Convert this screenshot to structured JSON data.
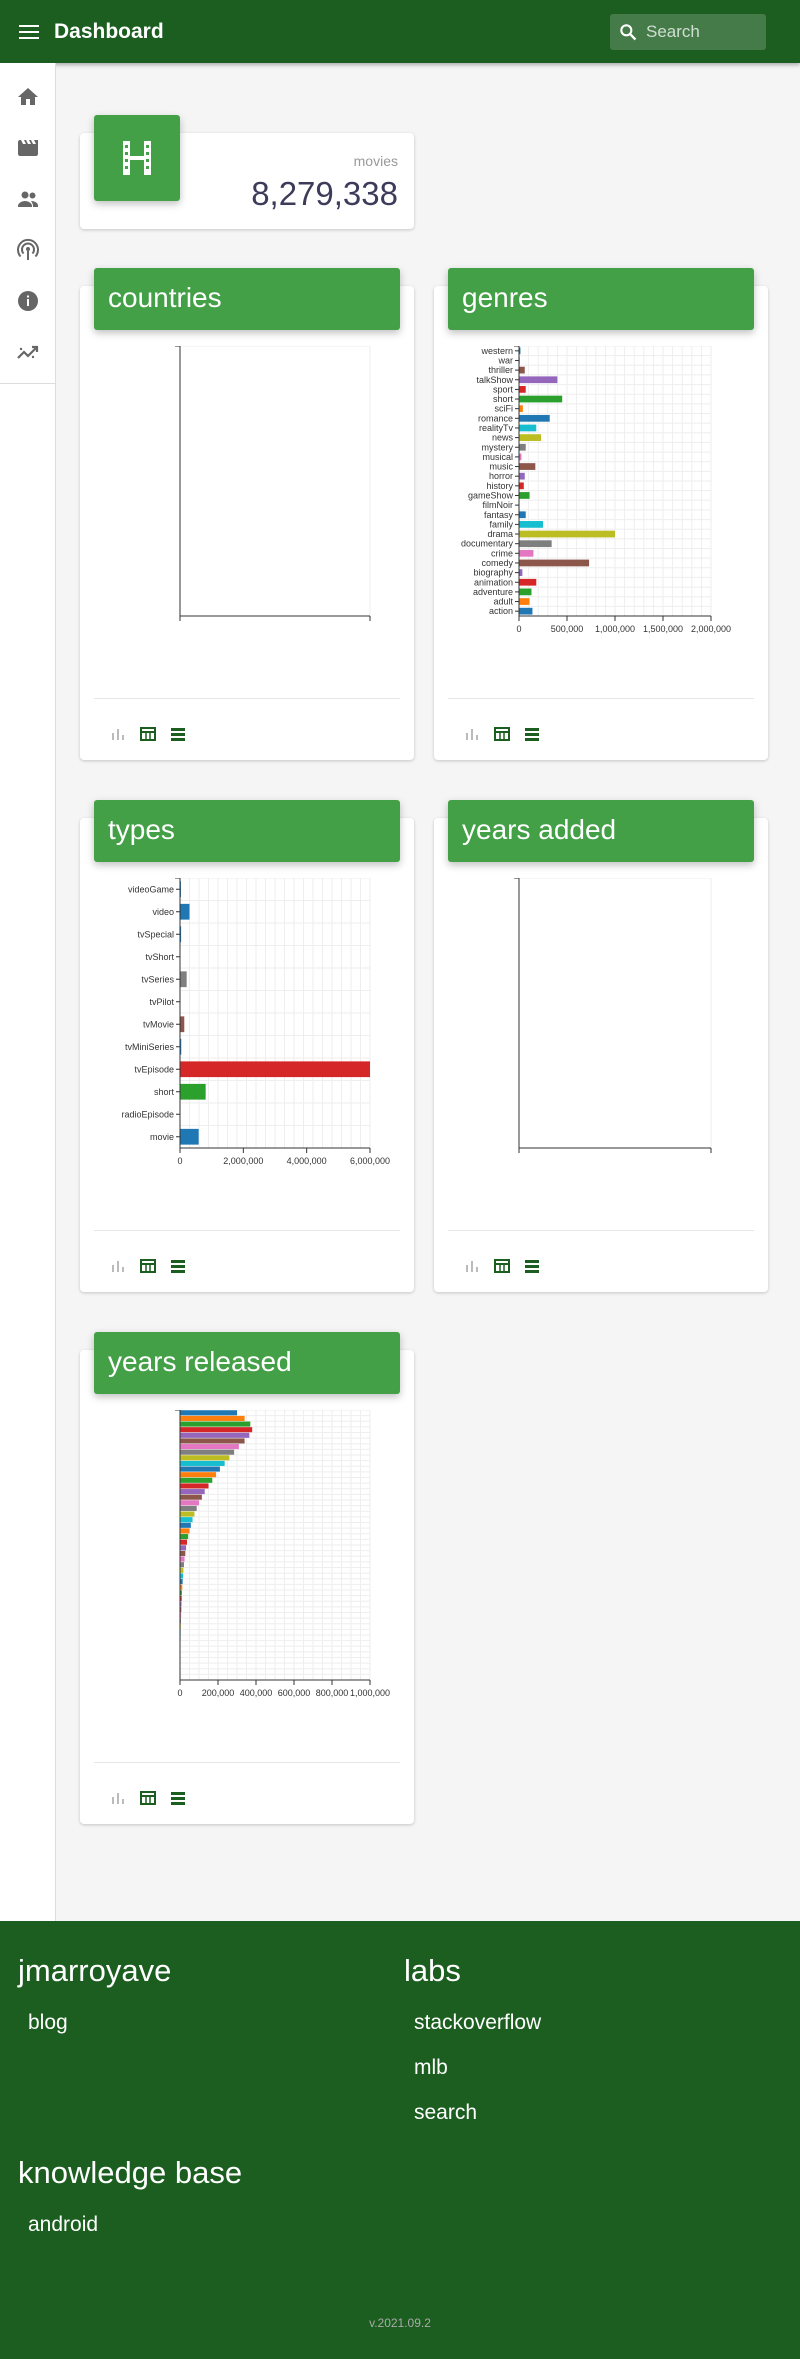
{
  "header": {
    "title": "Dashboard",
    "search_placeholder": "Search"
  },
  "sidebar": {
    "items": [
      "home-icon",
      "movie-icon",
      "people-icon",
      "podcast-icon",
      "info-icon",
      "trending-icon"
    ]
  },
  "stats": {
    "label": "movies",
    "value": "8,279,338"
  },
  "colors": {
    "dark_green": "#1b5e20",
    "green": "#43a047",
    "action_green": "#1b5e20"
  },
  "cards": {
    "countries": {
      "title": "countries"
    },
    "genres": {
      "title": "genres"
    },
    "types": {
      "title": "types"
    },
    "years_added": {
      "title": "years added"
    },
    "years_released": {
      "title": "years released"
    }
  },
  "chart_data": [
    {
      "type": "bar",
      "orientation": "horizontal",
      "id": "countries",
      "categories": [],
      "values": []
    },
    {
      "type": "bar",
      "orientation": "horizontal",
      "id": "genres",
      "categories": [
        "western",
        "war",
        "thriller",
        "talkShow",
        "sport",
        "short",
        "sciFi",
        "romance",
        "realityTv",
        "news",
        "mystery",
        "musical",
        "music",
        "horror",
        "history",
        "gameShow",
        "filmNoir",
        "fantasy",
        "family",
        "drama",
        "documentary",
        "crime",
        "comedy",
        "biography",
        "animation",
        "adventure",
        "adult",
        "action"
      ],
      "values": [
        15000,
        8000,
        60000,
        400000,
        70000,
        450000,
        40000,
        320000,
        180000,
        230000,
        70000,
        25000,
        170000,
        60000,
        50000,
        110000,
        3000,
        70000,
        250000,
        1000000,
        340000,
        150000,
        730000,
        35000,
        180000,
        130000,
        110000,
        140000
      ],
      "colors": [
        "#1f77b4",
        "#ff7f0e",
        "#8c564b",
        "#9467bd",
        "#d62728",
        "#2ca02c",
        "#ff7f0e",
        "#1f77b4",
        "#17becf",
        "#bcbd22",
        "#7f7f7f",
        "#e377c2",
        "#8c564b",
        "#9467bd",
        "#d62728",
        "#2ca02c",
        "#1f77b4",
        "#1f77b4",
        "#17becf",
        "#bcbd22",
        "#7f7f7f",
        "#e377c2",
        "#8c564b",
        "#9467bd",
        "#d62728",
        "#2ca02c",
        "#ff7f0e",
        "#1f77b4"
      ],
      "xticks": [
        "0",
        "500,000",
        "1,000,000",
        "1,500,000",
        "2,000,000"
      ],
      "xlim": [
        0,
        2000000
      ]
    },
    {
      "type": "bar",
      "orientation": "horizontal",
      "id": "types",
      "categories": [
        "videoGame",
        "video",
        "tvSpecial",
        "tvShort",
        "tvSeries",
        "tvPilot",
        "tvMovie",
        "tvMiniSeries",
        "tvEpisode",
        "short",
        "radioEpisode",
        "movie"
      ],
      "values": [
        30000,
        300000,
        35000,
        10000,
        210000,
        1000,
        135000,
        40000,
        6050000,
        810000,
        10,
        590000
      ],
      "colors": [
        "#1f77b4",
        "#1f77b4",
        "#1f77b4",
        "#1f77b4",
        "#7f7f7f",
        "#1f77b4",
        "#8c564b",
        "#1f77b4",
        "#d62728",
        "#2ca02c",
        "#1f77b4",
        "#1f77b4"
      ],
      "xticks": [
        "0",
        "2,000,000",
        "4,000,000",
        "6,000,000"
      ],
      "xlim": [
        0,
        6000000
      ]
    },
    {
      "type": "bar",
      "orientation": "horizontal",
      "id": "years_added",
      "categories": [],
      "values": []
    },
    {
      "type": "bar",
      "orientation": "horizontal",
      "id": "years_released",
      "values": [
        300000,
        340000,
        370000,
        380000,
        365000,
        340000,
        310000,
        285000,
        260000,
        235000,
        210000,
        190000,
        170000,
        150000,
        130000,
        115000,
        100000,
        88000,
        76000,
        66000,
        57000,
        50000,
        43000,
        37000,
        32000,
        28000,
        24000,
        21000,
        18000,
        16000,
        14000,
        12000,
        10000,
        9000,
        8000,
        7000,
        6000,
        5000,
        4000,
        3500,
        3000,
        2500,
        2000,
        1500,
        1000,
        800,
        600,
        400
      ],
      "xticks": [
        "0",
        "200,000",
        "400,000",
        "600,000",
        "800,000",
        "1,000,000"
      ],
      "xlim": [
        0,
        1000000
      ]
    }
  ],
  "footer": {
    "col1_title": "jmarroyave",
    "col1_links": [
      "blog"
    ],
    "col2_title": "labs",
    "col2_links": [
      "stackoverflow",
      "mlb",
      "search"
    ],
    "col3_title": "knowledge base",
    "col3_links": [
      "android"
    ],
    "version": "v.2021.09.2"
  }
}
